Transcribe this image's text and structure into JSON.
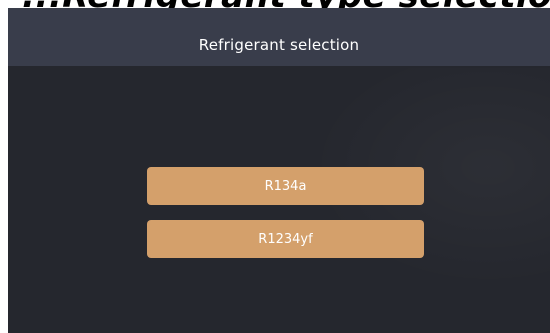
{
  "caption_fragment": "...Refrigerant type selection ...",
  "header": {
    "title": "Refrigerant selection"
  },
  "options": [
    {
      "label": "R134a"
    },
    {
      "label": "R1234yf"
    }
  ],
  "colors": {
    "background": "#25272e",
    "title_bar": "#393d4b",
    "button": "#d4a06b",
    "text": "#ffffff"
  }
}
